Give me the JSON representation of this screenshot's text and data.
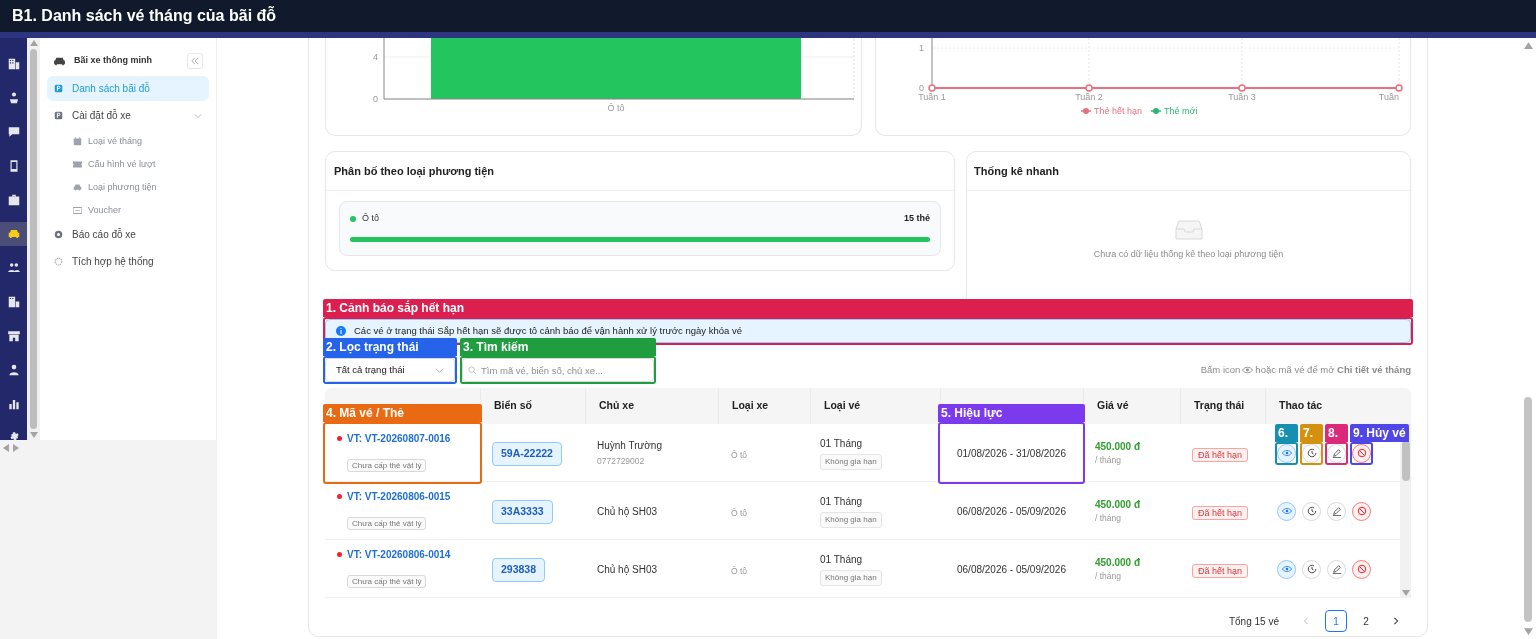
{
  "window": {
    "title": "B1. Danh sách vé tháng của bãi đỗ"
  },
  "rail_items": [
    {
      "selected": false
    },
    {
      "selected": false
    },
    {
      "selected": false
    },
    {
      "selected": false
    },
    {
      "selected": false
    },
    {
      "selected": true
    },
    {
      "selected": false
    },
    {
      "selected": false
    },
    {
      "selected": false
    },
    {
      "selected": false
    },
    {
      "selected": false
    },
    {
      "selected": false
    }
  ],
  "sidebar": {
    "title": "Bãi xe thông minh",
    "items": [
      {
        "label": "Danh sách bãi đỗ",
        "selected": true
      },
      {
        "label": "Cài đặt đỗ xe",
        "selected": false,
        "expanded": true,
        "children": [
          {
            "label": "Loại vé tháng",
            "selected": false
          },
          {
            "label": "Cấu hình vé lượt",
            "selected": false
          },
          {
            "label": "Loại phương tiện",
            "selected": false
          },
          {
            "label": "Voucher",
            "selected": false
          }
        ]
      },
      {
        "label": "Báo cáo đỗ xe",
        "selected": false
      },
      {
        "label": "Tích hợp hệ thống",
        "selected": false
      }
    ]
  },
  "vehicle_chart": {
    "y_tick_labels": [
      "4",
      "0"
    ],
    "category": "Ô tô"
  },
  "weekly_chart": {
    "y_tick_labels": [
      "1",
      "0"
    ],
    "x_labels": [
      "Tuần 1",
      "Tuần 2",
      "Tuần 3",
      "Tuần"
    ],
    "legend": [
      {
        "name": "Thẻ hết hạn",
        "color": "#e8707f"
      },
      {
        "name": "Thẻ mới",
        "color": "#2bb673"
      }
    ]
  },
  "distribution": {
    "title": "Phân bố theo loại phương tiện",
    "items": [
      {
        "label": "Ô tô",
        "count": "15 thẻ",
        "color": "#22c55e",
        "level": 1
      }
    ]
  },
  "quick_stats": {
    "title": "Thống kê nhanh",
    "empty_text": "Chưa có dữ liệu thống kê theo loại phương tiện"
  },
  "alert": {
    "text": "Các vé ở trạng thái Sắp hết hạn sẽ được tô cảnh báo để vận hành xử lý trước ngày khóa vé"
  },
  "filters": {
    "status": "Tất cả trạng thái",
    "search_placeholder": "Tìm mã vé, biển số, chủ xe..."
  },
  "hint": {
    "before": "Bấm icon",
    "after": "hoặc mã vé để mở **Chi tiết vé tháng**"
  },
  "table": {
    "columns": [
      {
        "kind": "covered"
      },
      {
        "kind": "text",
        "label": "Biển số"
      },
      {
        "kind": "text",
        "label": "Chủ xe"
      },
      {
        "kind": "text",
        "label": "Loại xe"
      },
      {
        "kind": "text",
        "label": "Loại vé"
      },
      {
        "kind": "covered"
      },
      {
        "kind": "text",
        "label": "Giá vé"
      },
      {
        "kind": "text",
        "label": "Trạng thái"
      },
      {
        "kind": "text",
        "label": "Thao tác"
      }
    ],
    "rows": [
      {
        "code": "VT: VT-20260807-0016",
        "card": "Chưa cấp thẻ vật lý",
        "plate": "59A-22222",
        "owner": "Huỳnh Trường",
        "phone": "0772729002",
        "vehicle": "Ô tô",
        "ticket": "01 Tháng",
        "renewal": "Không gia hạn",
        "validity": "01/08/2026 - 31/08/2026",
        "price": "450.000 đ",
        "unit": "/ tháng",
        "status": "Đã hết hạn"
      },
      {
        "code": "VT: VT-20260806-0015",
        "card": "Chưa cấp thẻ vật lý",
        "plate": "33A3333",
        "owner": "Chủ hộ SH03",
        "vehicle": "Ô tô",
        "ticket": "01 Tháng",
        "renewal": "Không gia hạn",
        "validity": "06/08/2026 - 05/09/2026",
        "price": "450.000 đ",
        "unit": "/ tháng",
        "status": "Đã hết hạn"
      },
      {
        "code": "VT: VT-20260806-0014",
        "card": "Chưa cấp thẻ vật lý",
        "plate": "293838",
        "owner": "Chủ hộ SH03",
        "vehicle": "Ô tô",
        "ticket": "01 Tháng",
        "renewal": "Không gia hạn",
        "validity": "06/08/2026 - 05/09/2026",
        "price": "450.000 đ",
        "unit": "/ tháng",
        "status": "Đã hết hạn"
      }
    ]
  },
  "pagination": {
    "total": "Tổng 15 vé",
    "prev_disabled": true,
    "pages": [
      {
        "label": "1",
        "selected": true
      },
      {
        "label": "2",
        "selected": false
      }
    ]
  },
  "callouts": [
    {
      "label": "1. Cảnh báo sắp hết hạn",
      "color": "#dc1f4f"
    },
    {
      "label": "2. Lọc trạng thái",
      "color": "#2563eb"
    },
    {
      "label": "3. Tìm kiếm",
      "color": "#1f9d3f"
    },
    {
      "label": "4. Mã vé / Thẻ",
      "color": "#ea6a14"
    },
    {
      "label": "5. Hiệu lực",
      "color": "#7c3aed"
    },
    {
      "label": "6.",
      "color": "#1590b0"
    },
    {
      "label": "7.",
      "color": "#d4900f"
    },
    {
      "label": "8.",
      "color": "#dc2a7a"
    },
    {
      "label": "9. Hủy vé",
      "color": "#4f46e5"
    }
  ]
}
